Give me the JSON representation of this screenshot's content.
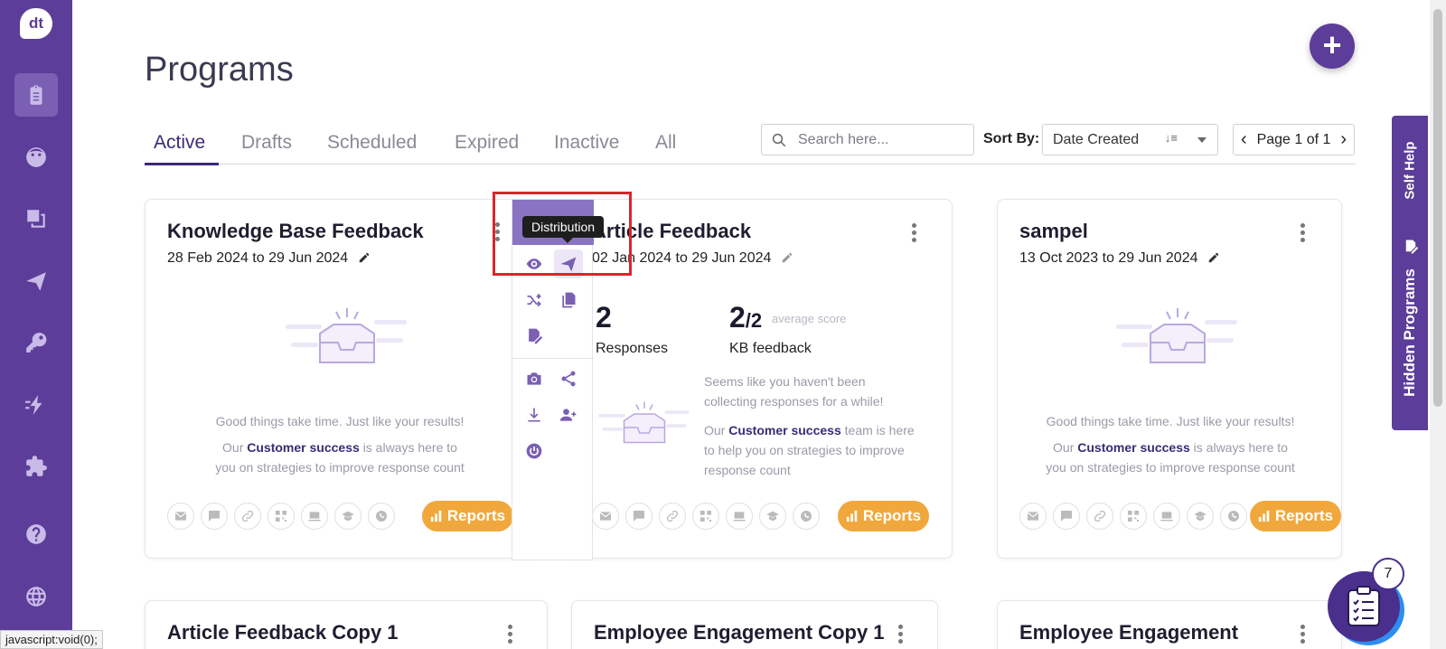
{
  "app": {
    "logo_text": "dt"
  },
  "sidebar": {
    "items": [
      {
        "icon": "clipboard-icon",
        "active": true
      },
      {
        "icon": "face-icon",
        "active": false
      },
      {
        "icon": "layers-icon",
        "active": false
      },
      {
        "icon": "send-icon",
        "active": false
      },
      {
        "icon": "key-icon",
        "active": false
      },
      {
        "icon": "flash-icon",
        "active": false
      },
      {
        "icon": "puzzle-icon",
        "active": false
      },
      {
        "icon": "help-icon",
        "active": false
      },
      {
        "icon": "globe-icon",
        "active": false
      }
    ]
  },
  "page": {
    "title": "Programs"
  },
  "tabs": [
    {
      "label": "Active"
    },
    {
      "label": "Drafts"
    },
    {
      "label": "Scheduled"
    },
    {
      "label": "Expired"
    },
    {
      "label": "Inactive"
    },
    {
      "label": "All"
    }
  ],
  "search": {
    "placeholder": "Search here..."
  },
  "sort": {
    "label": "Sort By:",
    "value": "Date Created",
    "icon_text": "↓≡"
  },
  "pager": {
    "text": "Page 1 of 1"
  },
  "fab": {
    "label": "+"
  },
  "cards": [
    {
      "title": "Knowledge Base Feedback",
      "date": "28 Feb 2024 to 29 Jun 2024",
      "empty_line1": "Good things take time. Just like your results!",
      "empty_line2_pre": "Our ",
      "empty_link": "Customer success",
      "empty_line2_post": " is always here to",
      "empty_line3": "you on strategies to improve response count",
      "reports": "Reports"
    },
    {
      "title": "Article Feedback",
      "date": "02 Jan 2024 to 29 Jun 2024",
      "responses": "2",
      "responses_label": "Responses",
      "score": "2",
      "score_den": "/2",
      "score_sub": "average score",
      "score_label": "KB feedback",
      "msg1": "Seems like you haven't been",
      "msg2": "collecting responses for a while!",
      "msg3_pre": "Our ",
      "msg3_link": "Customer success",
      "msg3_post": " team is here",
      "msg4": "to help you on strategies to improve",
      "msg5": "response count",
      "reports": "Reports"
    },
    {
      "title": "sampel",
      "date": "13 Oct 2023 to 29 Jun 2024",
      "empty_line1": "Good things take time. Just like your results!",
      "empty_line2_pre": "Our ",
      "empty_link": "Customer success",
      "empty_line2_post": " is always here to",
      "empty_line3": "you on strategies to improve response count",
      "reports": "Reports"
    },
    {
      "title": "Article Feedback Copy 1"
    },
    {
      "title": "Employee Engagement Copy 1"
    },
    {
      "title": "Employee Engagement"
    }
  ],
  "action_menu": {
    "tooltip": "Distribution"
  },
  "self_help": {
    "label": "Self Help",
    "hidden_label": "Hidden Programs"
  },
  "chat": {
    "badge": "7"
  },
  "statusbar": {
    "text": "javascript:void(0);"
  },
  "colors": {
    "brand": "#5c3d99",
    "accent": "#f0a83c",
    "highlight_box": "#d8262c"
  }
}
